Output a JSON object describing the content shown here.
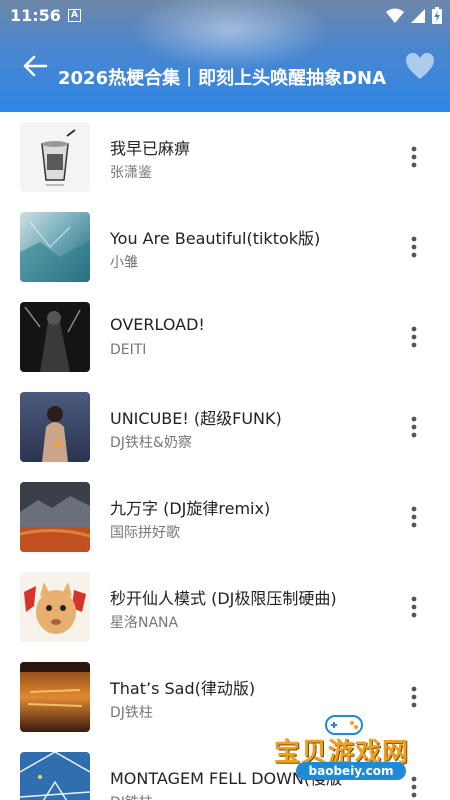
{
  "status_bar": {
    "time": "11:56",
    "notification_letter": "A"
  },
  "header": {
    "title": "2026热梗合集｜即刻上头唤醒抽象DNA",
    "back_icon": "arrow-left-icon",
    "favorite_icon": "heart-icon"
  },
  "songs": [
    {
      "title": "我早已麻痹",
      "artist": "张潇鉴"
    },
    {
      "title": "You Are Beautiful(tiktok版)",
      "artist": "小雏"
    },
    {
      "title": "OVERLOAD!",
      "artist": "DEITI"
    },
    {
      "title": "UNICUBE! (超级FUNK)",
      "artist": "DJ铁柱&奶察"
    },
    {
      "title": "九万字 (DJ旋律remix)",
      "artist": "国际拼好歌"
    },
    {
      "title": "秒开仙人模式 (DJ极限压制硬曲)",
      "artist": "星洛NANA"
    },
    {
      "title": "That’s Sad(律动版)",
      "artist": "DJ铁柱"
    },
    {
      "title": "MONTAGEM FELL DOWN(慢版",
      "artist": "DJ铁柱"
    }
  ],
  "watermark": {
    "name": "宝贝游戏网",
    "url": "baobeiy.com"
  }
}
